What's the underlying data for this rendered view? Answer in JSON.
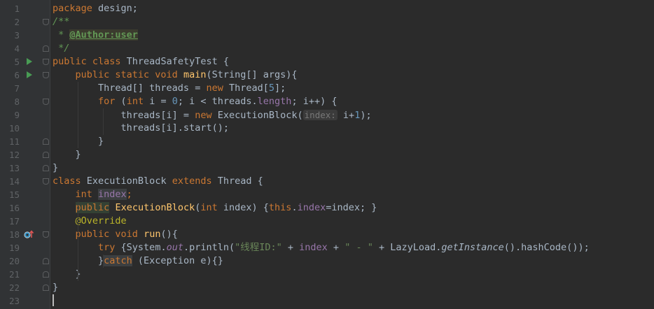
{
  "editor": {
    "line_numbers": [
      "1",
      "2",
      "3",
      "4",
      "5",
      "6",
      "7",
      "8",
      "9",
      "10",
      "11",
      "12",
      "13",
      "14",
      "15",
      "16",
      "17",
      "18",
      "19",
      "20",
      "21",
      "22",
      "23"
    ],
    "lines": [
      [
        {
          "t": "package ",
          "c": "kw"
        },
        {
          "t": "design;",
          "c": ""
        }
      ],
      [
        {
          "t": "/**",
          "c": "cmt"
        }
      ],
      [
        {
          "t": " * ",
          "c": "cmt"
        },
        {
          "t": "@Author:user",
          "c": "tag"
        }
      ],
      [
        {
          "t": " */",
          "c": "cmt"
        }
      ],
      [
        {
          "t": "public class ",
          "c": "kw"
        },
        {
          "t": "ThreadSafetyTest {",
          "c": ""
        }
      ],
      [
        {
          "t": "    public static void ",
          "c": "kw"
        },
        {
          "t": "main",
          "c": "method"
        },
        {
          "t": "(String[] args){",
          "c": ""
        }
      ],
      [
        {
          "t": "        Thread[] threads = ",
          "c": ""
        },
        {
          "t": "new ",
          "c": "kw"
        },
        {
          "t": "Thread[",
          "c": ""
        },
        {
          "t": "5",
          "c": "num"
        },
        {
          "t": "];",
          "c": ""
        }
      ],
      [
        {
          "t": "        ",
          "c": ""
        },
        {
          "t": "for ",
          "c": "kw"
        },
        {
          "t": "(",
          "c": ""
        },
        {
          "t": "int ",
          "c": "kw"
        },
        {
          "t": "i = ",
          "c": ""
        },
        {
          "t": "0",
          "c": "num"
        },
        {
          "t": "; i < threads.",
          "c": ""
        },
        {
          "t": "length",
          "c": "fld"
        },
        {
          "t": "; i++) {",
          "c": ""
        }
      ],
      [
        {
          "t": "            threads[i] = ",
          "c": ""
        },
        {
          "t": "new ",
          "c": "kw"
        },
        {
          "t": "ExecutionBlock(",
          "c": ""
        },
        {
          "t": "index:",
          "c": "hint"
        },
        {
          "t": " i+",
          "c": ""
        },
        {
          "t": "1",
          "c": "num"
        },
        {
          "t": ");",
          "c": ""
        }
      ],
      [
        {
          "t": "            threads[i].start();",
          "c": ""
        }
      ],
      [
        {
          "t": "        }",
          "c": ""
        }
      ],
      [
        {
          "t": "    }",
          "c": ""
        }
      ],
      [
        {
          "t": "}",
          "c": ""
        }
      ],
      [
        {
          "t": "class ",
          "c": "kw"
        },
        {
          "t": "ExecutionBlock ",
          "c": ""
        },
        {
          "t": "extends ",
          "c": "kw"
        },
        {
          "t": "Thread {",
          "c": ""
        }
      ],
      [
        {
          "t": "    ",
          "c": ""
        },
        {
          "t": "int ",
          "c": "kw"
        },
        {
          "t": "index",
          "c": "fld-hl"
        },
        {
          "t": ";",
          "c": "kw"
        }
      ],
      [
        {
          "t": "    ",
          "c": ""
        },
        {
          "t": "public",
          "c": "kw unused-hl"
        },
        {
          "t": " ",
          "c": ""
        },
        {
          "t": "ExecutionBlock",
          "c": "method"
        },
        {
          "t": "(",
          "c": ""
        },
        {
          "t": "int ",
          "c": "kw"
        },
        {
          "t": "index) {",
          "c": ""
        },
        {
          "t": "this",
          "c": "kw"
        },
        {
          "t": ".",
          "c": ""
        },
        {
          "t": "index",
          "c": "fld"
        },
        {
          "t": "=index; }",
          "c": ""
        }
      ],
      [
        {
          "t": "    ",
          "c": ""
        },
        {
          "t": "@Override",
          "c": "ann"
        }
      ],
      [
        {
          "t": "    ",
          "c": ""
        },
        {
          "t": "public void ",
          "c": "kw"
        },
        {
          "t": "run",
          "c": "method"
        },
        {
          "t": "(){",
          "c": ""
        }
      ],
      [
        {
          "t": "        ",
          "c": ""
        },
        {
          "t": "try ",
          "c": "kw"
        },
        {
          "t": "{System.",
          "c": ""
        },
        {
          "t": "out",
          "c": "static-it"
        },
        {
          "t": ".println(",
          "c": ""
        },
        {
          "t": "\"线程ID:\"",
          "c": "str"
        },
        {
          "t": " + ",
          "c": ""
        },
        {
          "t": "index",
          "c": "fld"
        },
        {
          "t": " + ",
          "c": ""
        },
        {
          "t": "\" - \"",
          "c": "str"
        },
        {
          "t": " + LazyLoad.",
          "c": ""
        },
        {
          "t": "getInstance",
          "c": "static-m"
        },
        {
          "t": "().hashCode());",
          "c": ""
        }
      ],
      [
        {
          "t": "        }",
          "c": ""
        },
        {
          "t": "catch",
          "c": "kw catch-hl"
        },
        {
          "t": " (Exception e){}",
          "c": ""
        }
      ],
      [
        {
          "t": "    }",
          "c": ""
        }
      ],
      [
        {
          "t": "}",
          "c": ""
        }
      ],
      [
        {
          "t": "",
          "c": ""
        }
      ]
    ]
  },
  "gutter": {
    "run_lines": [
      5,
      6
    ],
    "override_line": 18,
    "fold_open_lines": [
      2,
      5,
      6,
      8,
      14,
      18
    ],
    "fold_close_lines": [
      4,
      11,
      12,
      13,
      20,
      21,
      22
    ]
  },
  "colors": {
    "background": "#2b2b2b",
    "gutter": "#313335",
    "keyword": "#cc7832",
    "string": "#6a8759",
    "number": "#6897bb",
    "field": "#9876aa",
    "method": "#ffc66d",
    "comment": "#629755",
    "annotation": "#bbb529"
  }
}
